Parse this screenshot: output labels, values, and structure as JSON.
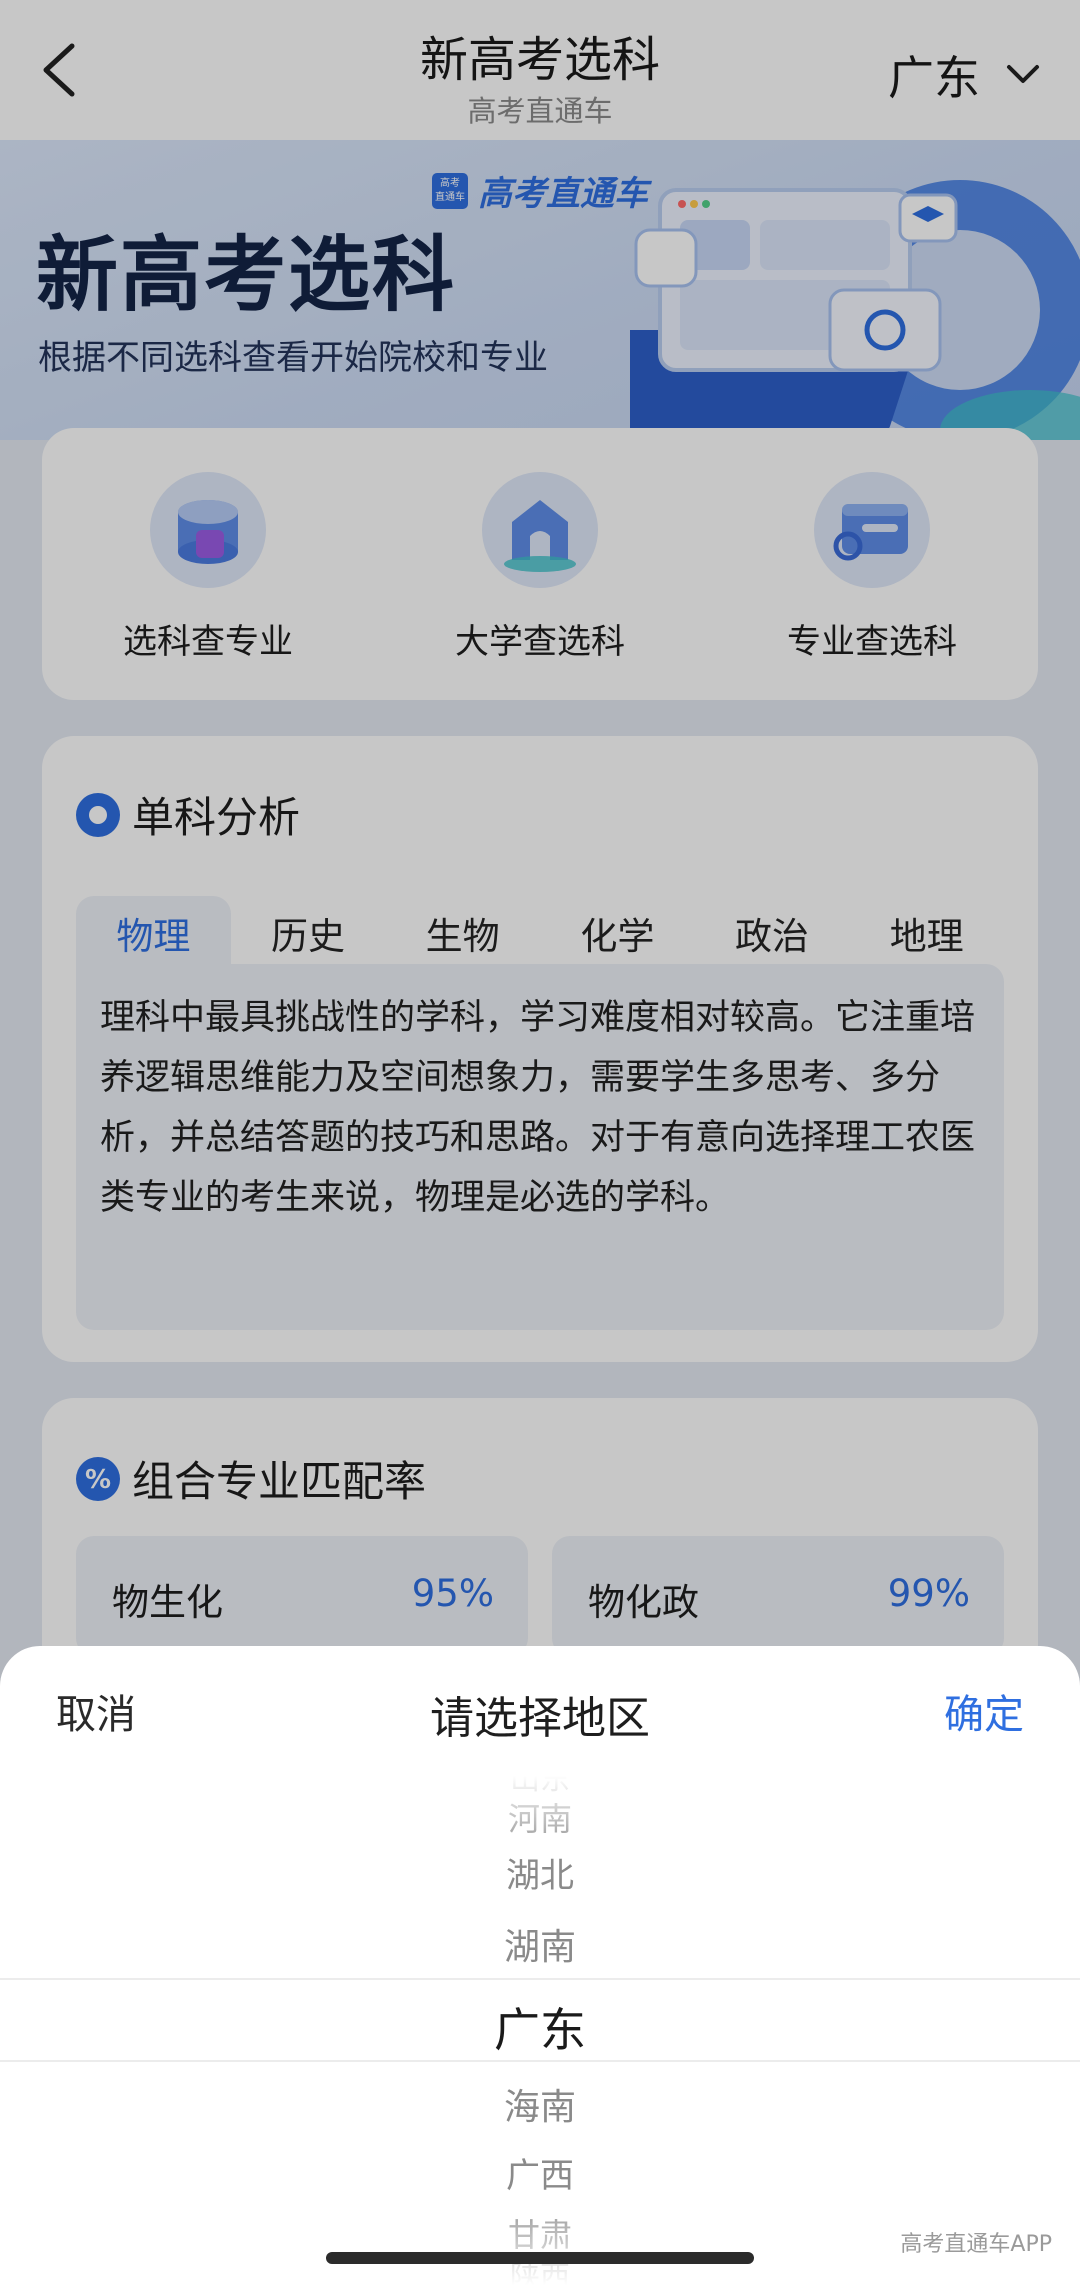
{
  "nav": {
    "title": "新高考选科",
    "subtitle": "高考直通车",
    "region": "广东"
  },
  "hero": {
    "brand": "高考直通车",
    "brand_badge": "高考直通车",
    "title": "新高考选科",
    "description": "根据不同选科查看开始院校和专业"
  },
  "quick_links": [
    {
      "label": "选科查专业",
      "icon": "cylinder-stack-icon"
    },
    {
      "label": "大学查选科",
      "icon": "university-building-icon"
    },
    {
      "label": "专业查选科",
      "icon": "window-search-icon"
    }
  ],
  "analysis": {
    "title": "单科分析",
    "tabs": [
      "物理",
      "历史",
      "生物",
      "化学",
      "政治",
      "地理"
    ],
    "active_tab": "物理",
    "description": "理科中最具挑战性的学科，学习难度相对较高。它注重培养逻辑思维能力及空间想象力，需要学生多思考、多分析，并总结答题的技巧和思路。对于有意向选择理工农医类专业的考生来说，物理是必选的学科。"
  },
  "match": {
    "title": "组合专业匹配率",
    "icon": "%",
    "items": [
      {
        "name": "物生化",
        "rate": "95%"
      },
      {
        "name": "物化政",
        "rate": "99%"
      }
    ]
  },
  "sheet": {
    "cancel": "取消",
    "title": "请选择地区",
    "confirm": "确定",
    "options": [
      "山东",
      "河南",
      "湖北",
      "湖南",
      "广东",
      "海南",
      "广西",
      "甘肃",
      "陕西"
    ],
    "selected": "广东"
  },
  "watermark": "高考直通车APP",
  "colors": {
    "accent": "#2f6fe0",
    "card_bg": "#ffffff",
    "panel_bg": "#edf1f8"
  }
}
